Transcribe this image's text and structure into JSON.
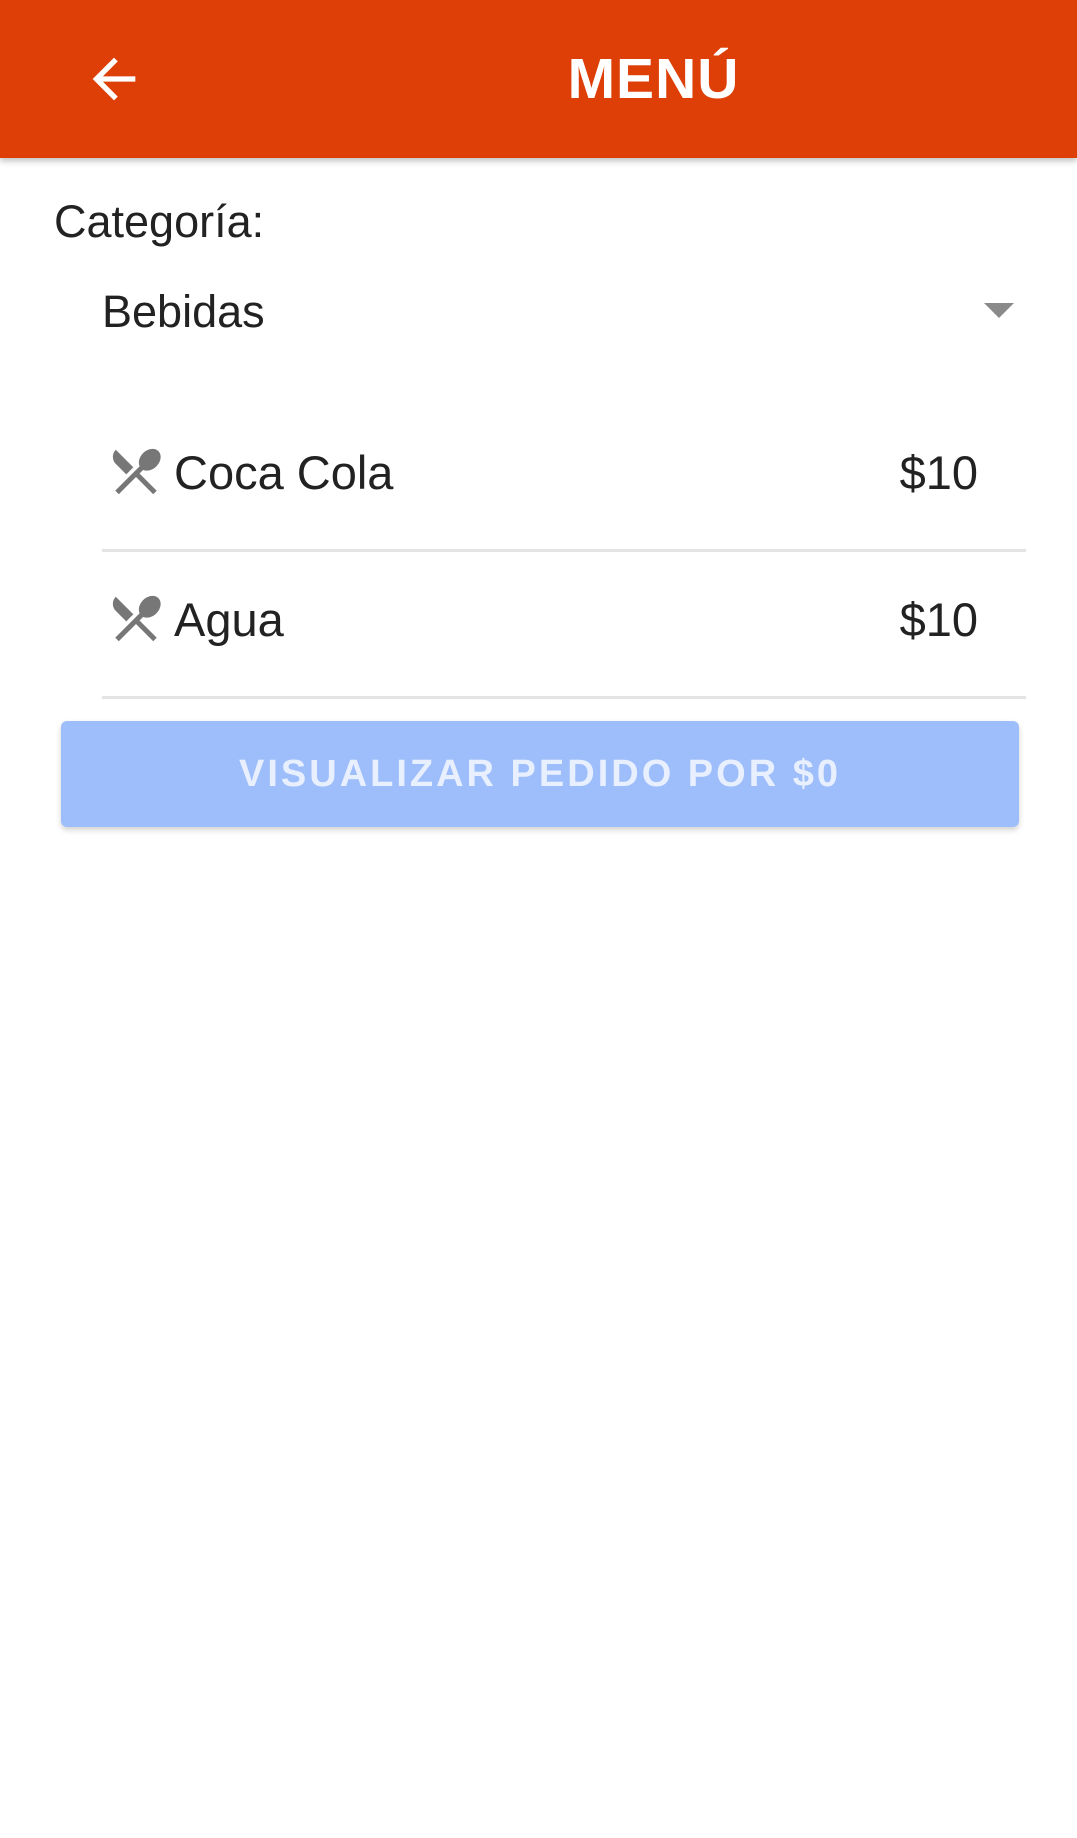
{
  "appbar": {
    "title": "MENÚ",
    "back_icon": "arrow-back-icon",
    "color": "#dd3f07"
  },
  "category": {
    "label": "Categoría:",
    "selected": "Bebidas",
    "dropdown_icon": "caret-down-icon"
  },
  "items": [
    {
      "name": "Coca Cola",
      "price": "$10",
      "icon": "utensils-icon"
    },
    {
      "name": "Agua",
      "price": "$10",
      "icon": "utensils-icon"
    }
  ],
  "order_button": {
    "label": "VISUALIZAR PEDIDO POR $0",
    "color": "#9ebefb",
    "state": "disabled"
  }
}
